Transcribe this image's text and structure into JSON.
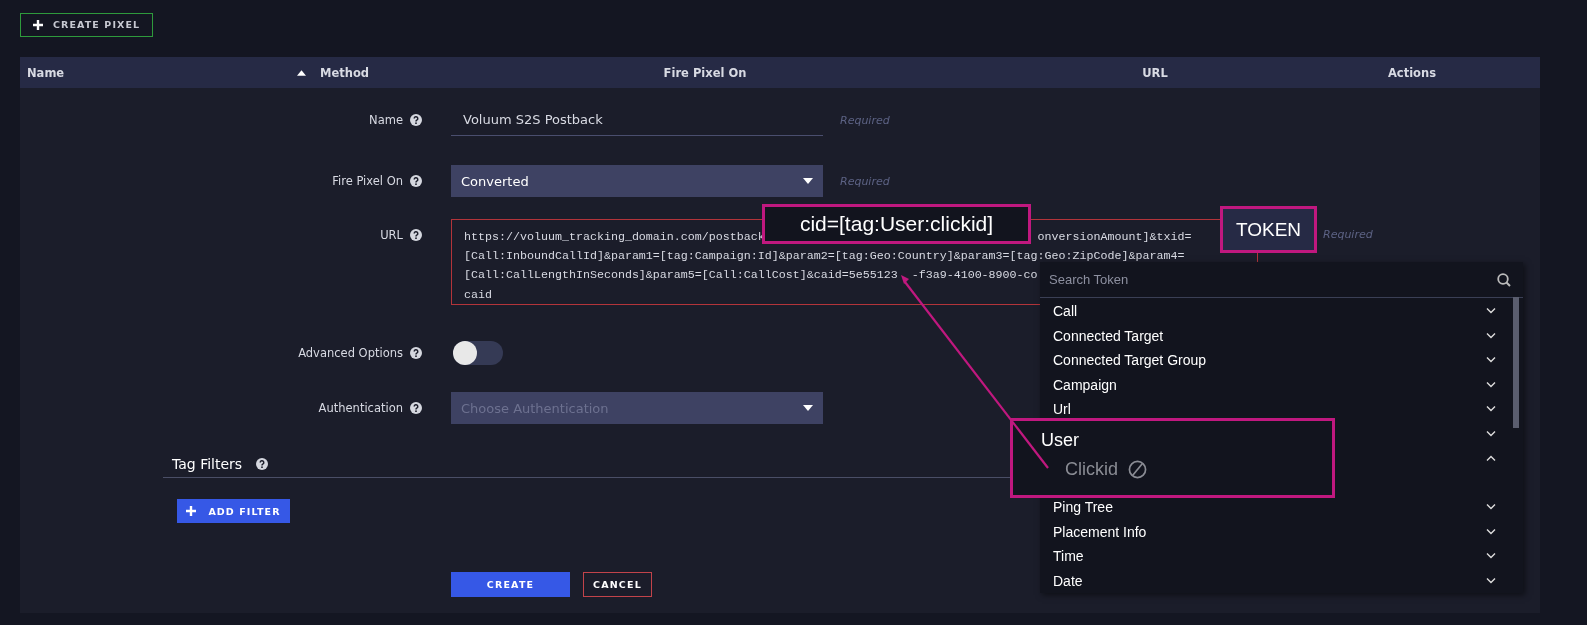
{
  "create_button": "CREATE PIXEL",
  "table": {
    "columns": [
      {
        "label": "Name",
        "sorted": true
      },
      {
        "label": "Method",
        "sorted": false
      },
      {
        "label": "Fire Pixel On",
        "sorted": false
      },
      {
        "label": "URL",
        "sorted": false
      },
      {
        "label": "Actions",
        "sorted": false
      }
    ]
  },
  "form": {
    "fields": [
      {
        "kind": "text",
        "label": "Name",
        "value": "Voluum S2S Postback",
        "hint": "Required"
      },
      {
        "kind": "select",
        "label": "Fire Pixel On",
        "value": "Converted",
        "hint": "Required"
      },
      {
        "kind": "url",
        "label": "URL",
        "hint": "Required",
        "lines": [
          [
            "https://voluum_tracking_domain.com/postback",
            "onversionAmount]&txid="
          ],
          [
            "[Call:InboundCallId]&param1=[tag:Campaign:Id]&param2=[tag:Geo:Country]&param3=[tag:Geo:ZipCode]&param4="
          ],
          [
            "[Call:CallLengthInSeconds]&param5=[Call:CallCost]&caid=5e55123",
            "-f3a9-4100-8900-co"
          ],
          [
            "caid"
          ]
        ]
      },
      {
        "kind": "toggle",
        "label": "Advanced Options",
        "on": false
      },
      {
        "kind": "select",
        "label": "Authentication",
        "placeholder": "Choose Authentication"
      }
    ]
  },
  "tag_filters": {
    "title": "Tag Filters",
    "add_button": "ADD FILTER"
  },
  "actions": [
    {
      "kind": "primary",
      "label": "CREATE"
    },
    {
      "kind": "outline",
      "label": "CANCEL"
    }
  ],
  "token_button": "TOKEN",
  "token_menu": {
    "placeholder": "Search Token",
    "groups": [
      {
        "label": "Call",
        "expanded": false
      },
      {
        "label": "Connected Target",
        "expanded": false
      },
      {
        "label": "Connected Target Group",
        "expanded": false
      },
      {
        "label": "Campaign",
        "expanded": false
      },
      {
        "label": "Url",
        "expanded": false
      },
      {
        "expanded": false
      },
      {
        "expanded": true
      },
      {
        "label": "Ping Tree",
        "expanded": false
      },
      {
        "label": "Placement Info",
        "expanded": false
      },
      {
        "label": "Time",
        "expanded": false
      },
      {
        "label": "Date",
        "expanded": false
      }
    ]
  },
  "callouts": [
    {
      "kind": "label",
      "text": "cid=[tag:User:clickid]"
    },
    {
      "kind": "zoom",
      "title": "User",
      "item": "Clickid",
      "disabled": true
    }
  ]
}
